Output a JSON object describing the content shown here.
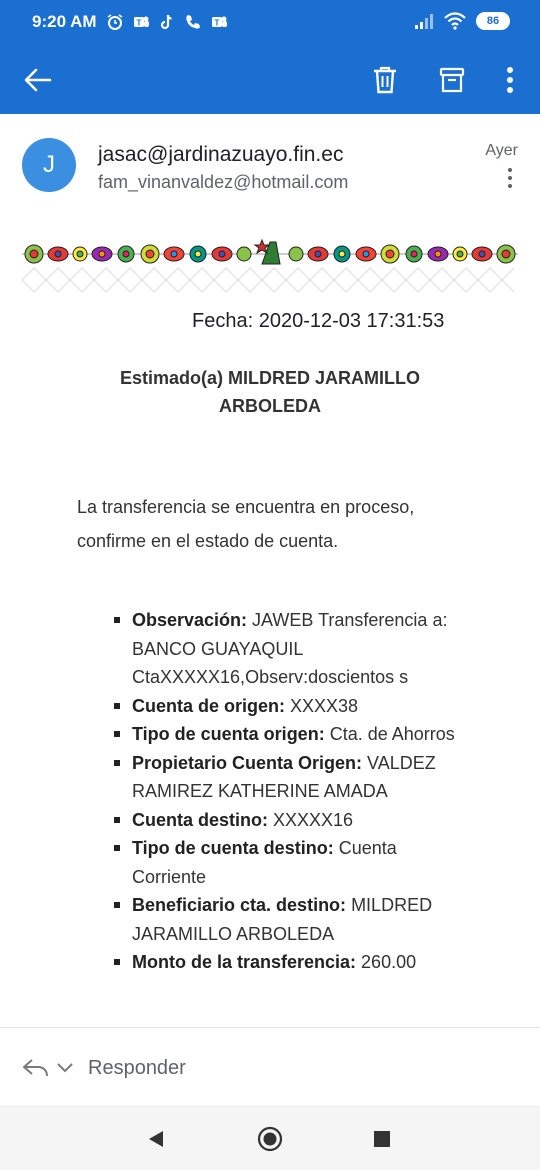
{
  "status_bar": {
    "time": "9:20 AM",
    "battery": "86",
    "notification_icons": [
      "alarm-icon",
      "teams-icon",
      "tiktok-icon",
      "phone-icon",
      "teams-icon"
    ],
    "system_icons": [
      "signal-icon",
      "wifi-icon",
      "battery-icon"
    ]
  },
  "app_bar": {
    "back_icon": "back-arrow-icon",
    "actions": [
      "delete-icon",
      "archive-icon",
      "more-vert-icon"
    ],
    "color": "#1b6fd1"
  },
  "email": {
    "avatar_letter": "J",
    "from": "jasac@jardinazuayo.fin.ec",
    "to": "fam_vinanvaldez@hotmail.com",
    "date": "Ayer",
    "fecha": "Fecha: 2020-12-03 17:31:53",
    "greeting_line1": "Estimado(a) MILDRED JARAMILLO",
    "greeting_line2": "ARBOLEDA",
    "message_line1": "La transferencia se encuentra en proceso,",
    "message_line2": "confirme en el estado de cuenta.",
    "details": [
      {
        "label": "Observación:",
        "value": " JAWEB Transferencia a: BANCO GUAYAQUIL CtaXXXXX16,Observ:doscientos s"
      },
      {
        "label": "Cuenta de origen:",
        "value": " XXXX38"
      },
      {
        "label": "Tipo de cuenta origen:",
        "value": " Cta. de Ahorros"
      },
      {
        "label": "Propietario Cuenta Origen:",
        "value": " VALDEZ RAMIREZ KATHERINE AMADA"
      },
      {
        "label": "Cuenta destino:",
        "value": " XXXXX16"
      },
      {
        "label": "Tipo de cuenta destino:",
        "value": " Cuenta Corriente"
      },
      {
        "label": "Beneficiario cta. destino:",
        "value": " MILDRED JARAMILLO ARBOLEDA"
      },
      {
        "label": "Monto de la transferencia:",
        "value": " 260.00"
      }
    ]
  },
  "reply_bar": {
    "label": "Responder"
  },
  "nav_bar": {
    "buttons": [
      "back-triangle-icon",
      "home-circle-icon",
      "recents-square-icon"
    ]
  }
}
